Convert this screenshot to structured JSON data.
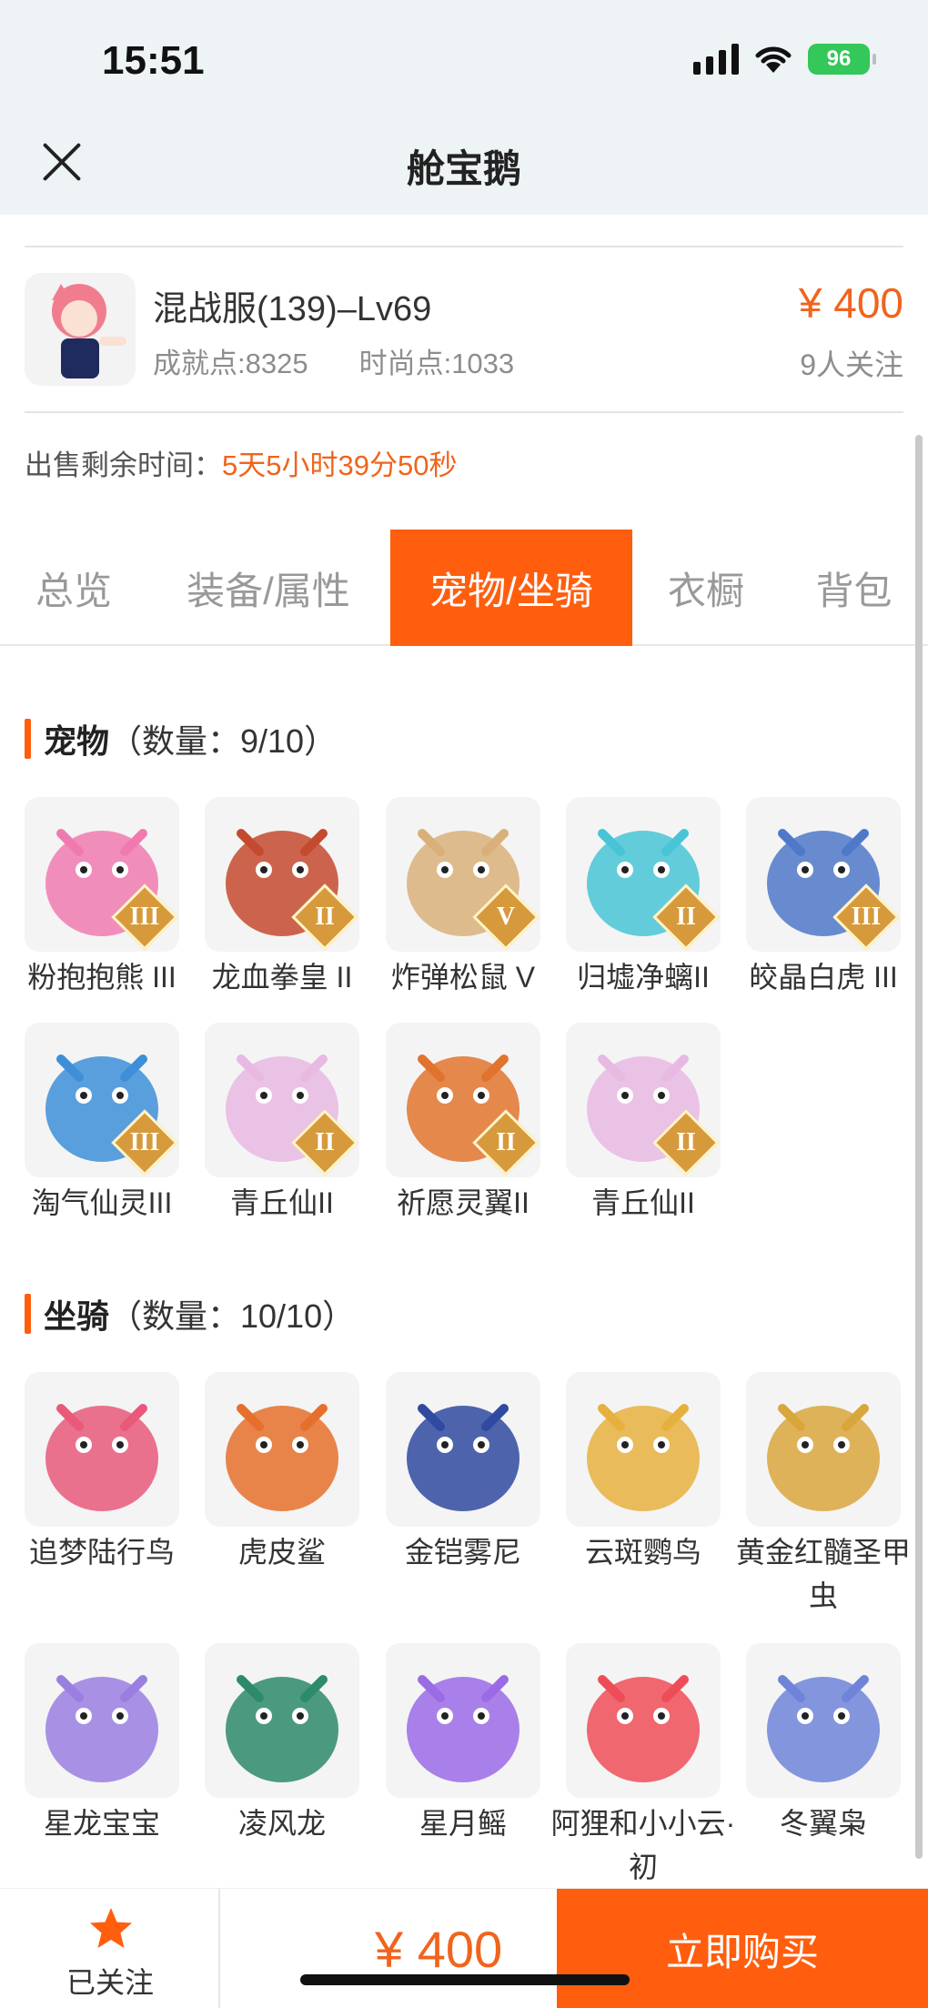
{
  "status_bar": {
    "time": "15:51",
    "battery": "96"
  },
  "nav": {
    "title": "舱宝鹅"
  },
  "listing": {
    "server_level": "混战服(139)–Lv69",
    "achievement": "成就点:8325",
    "fashion": "时尚点:1033",
    "price": "¥ 400",
    "followers": "9人关注",
    "remaining_label": "出售剩余时间：",
    "remaining_value": "5天5小时39分50秒"
  },
  "tabs": [
    {
      "label": "总览"
    },
    {
      "label": "装备/属性"
    },
    {
      "label": "宠物/坐骑",
      "active": true
    },
    {
      "label": "衣橱"
    },
    {
      "label": "背包"
    }
  ],
  "pets": {
    "title": "宠物",
    "count": "（数量：9/10）",
    "items": [
      {
        "name": "粉抱抱熊 III",
        "grade": "III",
        "color": "#f07ab0",
        "icon": "bear-icon"
      },
      {
        "name": "龙血拳皇 II",
        "grade": "II",
        "color": "#c44a2f",
        "icon": "dragon-icon"
      },
      {
        "name": "炸弹松鼠 V",
        "grade": "V",
        "color": "#d9b07a",
        "icon": "squirrel-icon"
      },
      {
        "name": "归墟净螭II",
        "grade": "II",
        "color": "#48c4d6",
        "icon": "serpent-icon"
      },
      {
        "name": "皎晶白虎 III",
        "grade": "III",
        "color": "#4f78c9",
        "icon": "tiger-icon"
      },
      {
        "name": "淘气仙灵III",
        "grade": "III",
        "color": "#3e8fd8",
        "icon": "spirit-icon"
      },
      {
        "name": "青丘仙II",
        "grade": "II",
        "color": "#e7b9e3",
        "icon": "fox-fairy-icon"
      },
      {
        "name": "祈愿灵翼II",
        "grade": "II",
        "color": "#e0742e",
        "icon": "bird-icon"
      },
      {
        "name": "青丘仙II",
        "grade": "II",
        "color": "#e7b9e3",
        "icon": "fox-fairy-icon"
      }
    ]
  },
  "mounts": {
    "title": "坐骑",
    "count": "（数量：10/10）",
    "items": [
      {
        "name": "追梦陆行鸟",
        "color": "#e8597a",
        "icon": "ostrich-icon"
      },
      {
        "name": "虎皮鲨",
        "color": "#e5702c",
        "icon": "shark-icon"
      },
      {
        "name": "金铠雾尼",
        "color": "#2f4aa0",
        "icon": "armored-bird-icon"
      },
      {
        "name": "云斑鹦鸟",
        "color": "#e6b03e",
        "icon": "parrot-icon"
      },
      {
        "name": "黄金红髓圣甲虫",
        "color": "#d9a63c",
        "icon": "beetle-icon"
      },
      {
        "name": "星龙宝宝",
        "color": "#9a7fe0",
        "icon": "baby-dragon-icon"
      },
      {
        "name": "凌风龙",
        "color": "#2d8a6a",
        "icon": "wind-dragon-icon"
      },
      {
        "name": "星月鳐",
        "color": "#9b6be6",
        "icon": "ray-icon"
      },
      {
        "name": "阿狸和小小云·初",
        "color": "#ee4d57",
        "icon": "fox-cloud-icon"
      },
      {
        "name": "冬翼枭",
        "color": "#6f84d8",
        "icon": "owl-icon"
      }
    ]
  },
  "bottom_bar": {
    "fav_label": "已关注",
    "price": "¥ 400",
    "buy_label": "立即购买"
  }
}
